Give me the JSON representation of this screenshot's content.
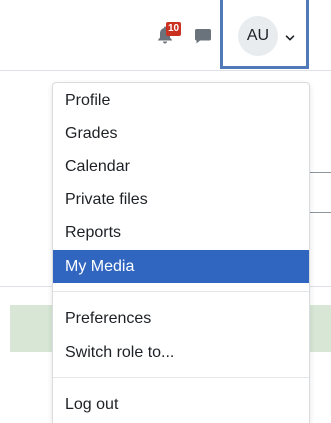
{
  "navbar": {
    "notifications": {
      "icon": "bell-icon",
      "count": "10",
      "badge_color": "#ca3120"
    },
    "messages": {
      "icon": "speech-bubble-icon"
    },
    "user": {
      "initials": "AU",
      "caret_icon": "chevron-down-icon",
      "focus_color": "#4f79b8"
    }
  },
  "user_menu": {
    "group1": [
      {
        "label": "Profile"
      },
      {
        "label": "Grades"
      },
      {
        "label": "Calendar"
      },
      {
        "label": "Private files"
      },
      {
        "label": "Reports"
      },
      {
        "label": "My Media",
        "active": true
      }
    ],
    "group2": [
      {
        "label": "Preferences"
      },
      {
        "label": "Switch role to..."
      }
    ],
    "group3": [
      {
        "label": "Log out"
      }
    ],
    "active_color": "#3066c0"
  }
}
